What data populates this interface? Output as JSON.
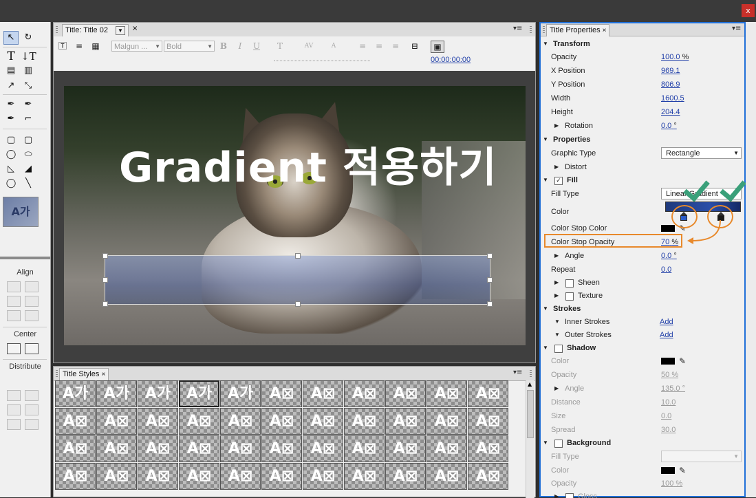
{
  "window": {
    "close_glyph": "x"
  },
  "tools_panel": {
    "align_label": "Align",
    "center_label": "Center",
    "distribute_label": "Distribute",
    "style_preview": "A가"
  },
  "title_panel": {
    "tab_label": "Title: Title 02",
    "font_family": "Malgun ...",
    "font_style": "Bold",
    "timecode": "00:00:00:00",
    "canvas_title": "Gradient 적용하기"
  },
  "styles_panel": {
    "tab_label": "Title Styles",
    "rows": [
      [
        "A가",
        "A가",
        "A가",
        "A가",
        "A가",
        "A⊠",
        "A⊠",
        "A⊠",
        "A⊠",
        "A⊠",
        "A⊠"
      ],
      [
        "A⊠",
        "A⊠",
        "A⊠",
        "A⊠",
        "A⊠",
        "A⊠",
        "A⊠",
        "A⊠",
        "A⊠",
        "A⊠",
        "A⊠"
      ],
      [
        "A⊠",
        "A⊠",
        "A⊠",
        "A⊠",
        "A⊠",
        "A⊠",
        "A⊠",
        "A⊠",
        "A⊠",
        "A⊠",
        "A⊠"
      ],
      [
        "A⊠",
        "A⊠",
        "A⊠",
        "A⊠",
        "A⊠",
        "A⊠",
        "A⊠",
        "A⊠",
        "A⊠",
        "A⊠",
        "A⊠"
      ]
    ]
  },
  "properties": {
    "tab_label": "Title Properties",
    "transform": {
      "label": "Transform",
      "opacity_label": "Opacity",
      "opacity_value": "100.0",
      "opacity_unit": "%",
      "x_label": "X Position",
      "x_value": "969.1",
      "y_label": "Y Position",
      "y_value": "806.9",
      "width_label": "Width",
      "width_value": "1600.5",
      "height_label": "Height",
      "height_value": "204.4",
      "rotation_label": "Rotation",
      "rotation_value": "0.0",
      "rotation_unit": "°"
    },
    "props": {
      "label": "Properties",
      "graphic_type_label": "Graphic Type",
      "graphic_type_value": "Rectangle",
      "distort_label": "Distort"
    },
    "fill": {
      "label": "Fill",
      "fill_type_label": "Fill Type",
      "fill_type_value": "Linear Gradient",
      "color_label": "Color",
      "stop_color_label": "Color Stop Color",
      "stop_opacity_label": "Color Stop Opacity",
      "stop_opacity_value": "70",
      "stop_opacity_unit": "%",
      "angle_label": "Angle",
      "angle_value": "0.0",
      "angle_unit": "°",
      "repeat_label": "Repeat",
      "repeat_value": "0.0",
      "sheen_label": "Sheen",
      "texture_label": "Texture"
    },
    "strokes": {
      "label": "Strokes",
      "inner_label": "Inner Strokes",
      "inner_add": "Add",
      "outer_label": "Outer Strokes",
      "outer_add": "Add"
    },
    "shadow": {
      "label": "Shadow",
      "color_label": "Color",
      "opacity_label": "Opacity",
      "opacity_value": "50",
      "opacity_unit": "%",
      "angle_label": "Angle",
      "angle_value": "135.0",
      "angle_unit": "°",
      "distance_label": "Distance",
      "distance_value": "10.0",
      "size_label": "Size",
      "size_value": "0.0",
      "spread_label": "Spread",
      "spread_value": "30.0"
    },
    "background": {
      "label": "Background",
      "fill_type_label": "Fill Type",
      "color_label": "Color",
      "opacity_label": "Opacity",
      "opacity_value": "100",
      "opacity_unit": "%",
      "gloss_label": "Gloss"
    }
  },
  "colors": {
    "accent_highlight": "#e8892b",
    "checkmark": "#3aa07a",
    "link_blue": "#1f3ea8",
    "gradient_fill": "#2a4ea8"
  }
}
